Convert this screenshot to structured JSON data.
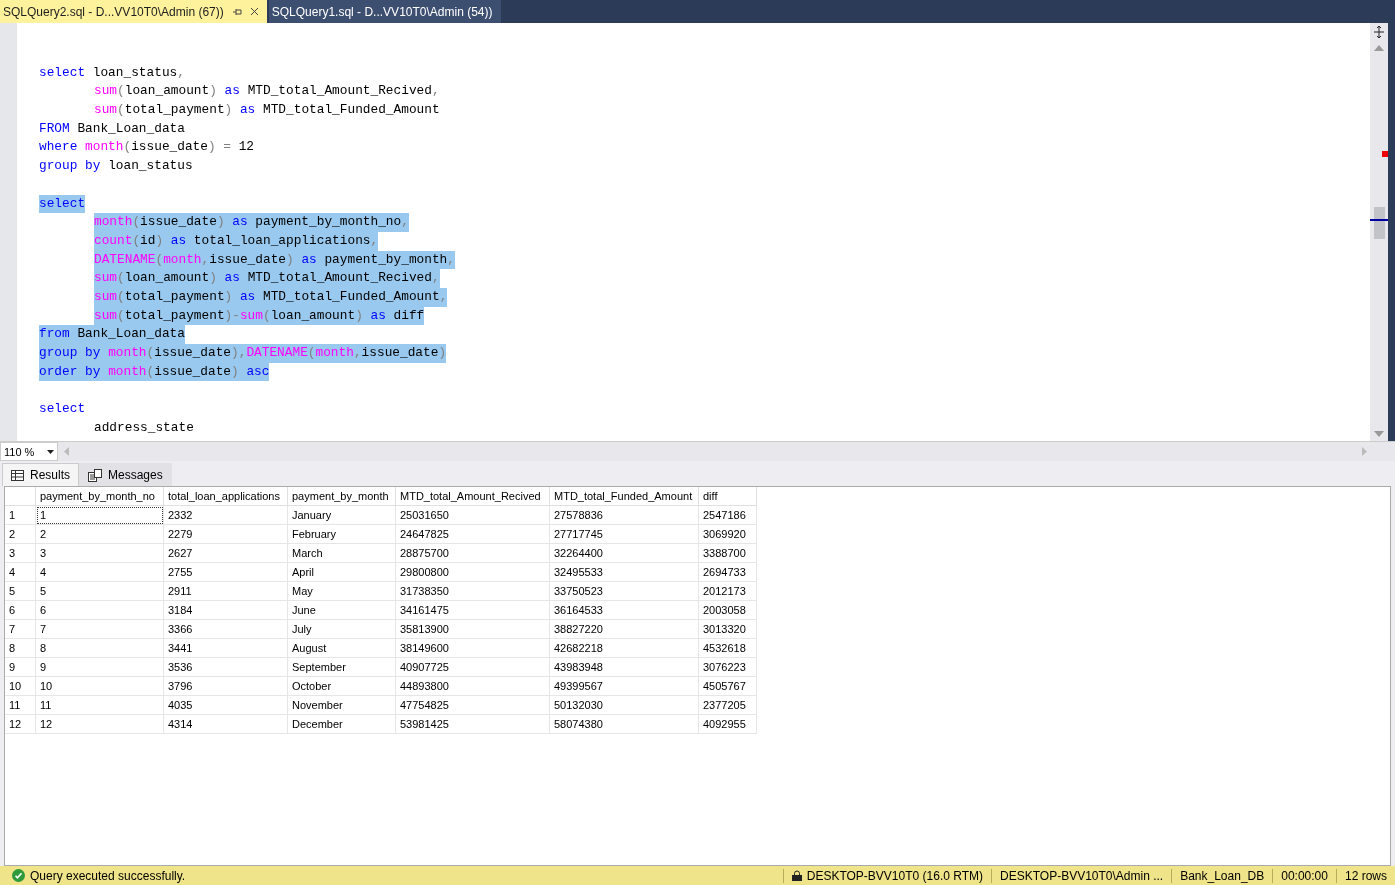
{
  "tabs": [
    {
      "label": "SQLQuery2.sql - D...VV10T0\\Admin (67))",
      "selected": true
    },
    {
      "label": "SQLQuery1.sql - D...VV10T0\\Admin (54))",
      "selected": false
    }
  ],
  "editor": {
    "lines": [
      {
        "space_before": true,
        "indented": false,
        "selected": false,
        "tokens": [
          {
            "kind": "kw",
            "t": "select "
          },
          {
            "kind": "tx",
            "t": "loan_status"
          },
          {
            "kind": "op",
            "t": ","
          }
        ]
      },
      {
        "space_before": false,
        "indented": true,
        "selected": false,
        "tokens": [
          {
            "kind": "fn",
            "t": "sum"
          },
          {
            "kind": "op",
            "t": "("
          },
          {
            "kind": "tx",
            "t": "loan_amount"
          },
          {
            "kind": "op",
            "t": ") "
          },
          {
            "kind": "kw",
            "t": "as "
          },
          {
            "kind": "tx",
            "t": "MTD_total_Amount_Recived"
          },
          {
            "kind": "op",
            "t": ","
          }
        ]
      },
      {
        "space_before": false,
        "indented": true,
        "selected": false,
        "tokens": [
          {
            "kind": "fn",
            "t": "sum"
          },
          {
            "kind": "op",
            "t": "("
          },
          {
            "kind": "tx",
            "t": "total_payment"
          },
          {
            "kind": "op",
            "t": ") "
          },
          {
            "kind": "kw",
            "t": "as "
          },
          {
            "kind": "tx",
            "t": "MTD_total_Funded_Amount"
          }
        ]
      },
      {
        "space_before": false,
        "indented": false,
        "selected": false,
        "tokens": [
          {
            "kind": "kw",
            "t": "FROM "
          },
          {
            "kind": "tx",
            "t": "Bank_Loan_data"
          }
        ]
      },
      {
        "space_before": false,
        "indented": false,
        "selected": false,
        "tokens": [
          {
            "kind": "kw",
            "t": "where "
          },
          {
            "kind": "fn",
            "t": "month"
          },
          {
            "kind": "op",
            "t": "("
          },
          {
            "kind": "tx",
            "t": "issue_date"
          },
          {
            "kind": "op",
            "t": ") = "
          },
          {
            "kind": "tx",
            "t": "12"
          }
        ]
      },
      {
        "space_before": false,
        "indented": false,
        "selected": false,
        "tokens": [
          {
            "kind": "kw",
            "t": "group by "
          },
          {
            "kind": "tx",
            "t": "loan_status"
          }
        ]
      },
      {
        "space_before": true,
        "indented": false,
        "selected": true,
        "tokens": [
          {
            "kind": "kw",
            "t": "select"
          }
        ]
      },
      {
        "space_before": false,
        "indented": true,
        "selected": true,
        "tokens": [
          {
            "kind": "fn",
            "t": "month"
          },
          {
            "kind": "op",
            "t": "("
          },
          {
            "kind": "tx",
            "t": "issue_date"
          },
          {
            "kind": "op",
            "t": ") "
          },
          {
            "kind": "kw",
            "t": "as "
          },
          {
            "kind": "tx",
            "t": "payment_by_month_no"
          },
          {
            "kind": "op",
            "t": ","
          }
        ]
      },
      {
        "space_before": false,
        "indented": true,
        "selected": true,
        "tokens": [
          {
            "kind": "fn",
            "t": "count"
          },
          {
            "kind": "op",
            "t": "("
          },
          {
            "kind": "tx",
            "t": "id"
          },
          {
            "kind": "op",
            "t": ") "
          },
          {
            "kind": "kw",
            "t": "as "
          },
          {
            "kind": "tx",
            "t": "total_loan_applications"
          },
          {
            "kind": "op",
            "t": ","
          }
        ]
      },
      {
        "space_before": false,
        "indented": true,
        "selected": true,
        "tokens": [
          {
            "kind": "fn",
            "t": "DATENAME"
          },
          {
            "kind": "op",
            "t": "("
          },
          {
            "kind": "fn",
            "t": "month"
          },
          {
            "kind": "op",
            "t": ","
          },
          {
            "kind": "tx",
            "t": "issue_date"
          },
          {
            "kind": "op",
            "t": ") "
          },
          {
            "kind": "kw",
            "t": "as "
          },
          {
            "kind": "tx",
            "t": "payment_by_month"
          },
          {
            "kind": "op",
            "t": ","
          }
        ]
      },
      {
        "space_before": false,
        "indented": true,
        "selected": true,
        "tokens": [
          {
            "kind": "fn",
            "t": "sum"
          },
          {
            "kind": "op",
            "t": "("
          },
          {
            "kind": "tx",
            "t": "loan_amount"
          },
          {
            "kind": "op",
            "t": ") "
          },
          {
            "kind": "kw",
            "t": "as "
          },
          {
            "kind": "tx",
            "t": "MTD_total_Amount_Recived"
          },
          {
            "kind": "op",
            "t": ","
          }
        ]
      },
      {
        "space_before": false,
        "indented": true,
        "selected": true,
        "tokens": [
          {
            "kind": "fn",
            "t": "sum"
          },
          {
            "kind": "op",
            "t": "("
          },
          {
            "kind": "tx",
            "t": "total_payment"
          },
          {
            "kind": "op",
            "t": ") "
          },
          {
            "kind": "kw",
            "t": "as "
          },
          {
            "kind": "tx",
            "t": "MTD_total_Funded_Amount"
          },
          {
            "kind": "op",
            "t": ","
          }
        ]
      },
      {
        "space_before": false,
        "indented": true,
        "selected": true,
        "tokens": [
          {
            "kind": "fn",
            "t": "sum"
          },
          {
            "kind": "op",
            "t": "("
          },
          {
            "kind": "tx",
            "t": "total_payment"
          },
          {
            "kind": "op",
            "t": ")-"
          },
          {
            "kind": "fn",
            "t": "sum"
          },
          {
            "kind": "op",
            "t": "("
          },
          {
            "kind": "tx",
            "t": "loan_amount"
          },
          {
            "kind": "op",
            "t": ") "
          },
          {
            "kind": "kw",
            "t": "as "
          },
          {
            "kind": "tx",
            "t": "diff"
          }
        ]
      },
      {
        "space_before": false,
        "indented": false,
        "selected": true,
        "tokens": [
          {
            "kind": "kw",
            "t": "from "
          },
          {
            "kind": "tx",
            "t": "Bank_Loan_data"
          }
        ]
      },
      {
        "space_before": false,
        "indented": false,
        "selected": true,
        "tokens": [
          {
            "kind": "kw",
            "t": "group by "
          },
          {
            "kind": "fn",
            "t": "month"
          },
          {
            "kind": "op",
            "t": "("
          },
          {
            "kind": "tx",
            "t": "issue_date"
          },
          {
            "kind": "op",
            "t": "),"
          },
          {
            "kind": "fn",
            "t": "DATENAME"
          },
          {
            "kind": "op",
            "t": "("
          },
          {
            "kind": "fn",
            "t": "month"
          },
          {
            "kind": "op",
            "t": ","
          },
          {
            "kind": "tx",
            "t": "issue_date"
          },
          {
            "kind": "op",
            "t": ")"
          }
        ]
      },
      {
        "space_before": false,
        "indented": false,
        "selected": true,
        "tokens": [
          {
            "kind": "kw",
            "t": "order by "
          },
          {
            "kind": "fn",
            "t": "month"
          },
          {
            "kind": "op",
            "t": "("
          },
          {
            "kind": "tx",
            "t": "issue_date"
          },
          {
            "kind": "op",
            "t": ") "
          },
          {
            "kind": "kw",
            "t": "asc"
          }
        ]
      },
      {
        "space_before": true,
        "indented": false,
        "selected": false,
        "tokens": [
          {
            "kind": "kw",
            "t": "select"
          }
        ]
      },
      {
        "space_before": false,
        "indented": true,
        "selected": false,
        "tokens": [
          {
            "kind": "tx",
            "t": "address_state"
          }
        ]
      }
    ]
  },
  "zoom": {
    "value": "110 %"
  },
  "result_tabs": [
    {
      "label": "Results",
      "selected": true
    },
    {
      "label": "Messages",
      "selected": false
    }
  ],
  "grid": {
    "columns": [
      "payment_by_month_no",
      "total_loan_applications",
      "payment_by_month",
      "MTD_total_Amount_Recived",
      "MTD_total_Funded_Amount",
      "diff"
    ],
    "rows": [
      {
        "num": "1",
        "focused": true,
        "cells": [
          "1",
          "2332",
          "January",
          "25031650",
          "27578836",
          "2547186"
        ]
      },
      {
        "num": "2",
        "focused": false,
        "cells": [
          "2",
          "2279",
          "February",
          "24647825",
          "27717745",
          "3069920"
        ]
      },
      {
        "num": "3",
        "focused": false,
        "cells": [
          "3",
          "2627",
          "March",
          "28875700",
          "32264400",
          "3388700"
        ]
      },
      {
        "num": "4",
        "focused": false,
        "cells": [
          "4",
          "2755",
          "April",
          "29800800",
          "32495533",
          "2694733"
        ]
      },
      {
        "num": "5",
        "focused": false,
        "cells": [
          "5",
          "2911",
          "May",
          "31738350",
          "33750523",
          "2012173"
        ]
      },
      {
        "num": "6",
        "focused": false,
        "cells": [
          "6",
          "3184",
          "June",
          "34161475",
          "36164533",
          "2003058"
        ]
      },
      {
        "num": "7",
        "focused": false,
        "cells": [
          "7",
          "3366",
          "July",
          "35813900",
          "38827220",
          "3013320"
        ]
      },
      {
        "num": "8",
        "focused": false,
        "cells": [
          "8",
          "3441",
          "August",
          "38149600",
          "42682218",
          "4532618"
        ]
      },
      {
        "num": "9",
        "focused": false,
        "cells": [
          "9",
          "3536",
          "September",
          "40907725",
          "43983948",
          "3076223"
        ]
      },
      {
        "num": "10",
        "focused": false,
        "cells": [
          "10",
          "3796",
          "October",
          "44893800",
          "49399567",
          "4505767"
        ]
      },
      {
        "num": "11",
        "focused": false,
        "cells": [
          "11",
          "4035",
          "November",
          "47754825",
          "50132030",
          "2377205"
        ]
      },
      {
        "num": "12",
        "focused": false,
        "cells": [
          "12",
          "4314",
          "December",
          "53981425",
          "58074380",
          "4092955"
        ]
      }
    ]
  },
  "status_bar": {
    "message": "Query executed successfully.",
    "server": "DESKTOP-BVV10T0 (16.0 RTM)",
    "user": "DESKTOP-BVV10T0\\Admin ...",
    "database": "Bank_Loan_DB",
    "elapsed": "00:00:00",
    "rows": "12 rows"
  }
}
